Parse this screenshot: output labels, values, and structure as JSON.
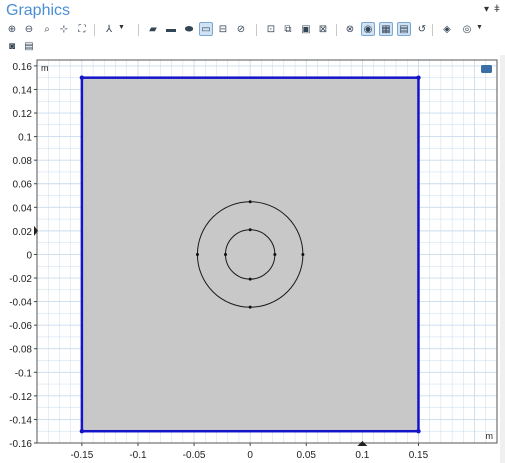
{
  "window": {
    "title": "Graphics"
  },
  "toolbar": {
    "row1": [
      {
        "name": "zoom-in-icon",
        "glyph": "⊕"
      },
      {
        "name": "zoom-out-icon",
        "glyph": "⊖"
      },
      {
        "name": "zoom-box-icon",
        "glyph": "⌕"
      },
      {
        "name": "zoom-selected-icon",
        "glyph": "⊹"
      },
      {
        "name": "zoom-extents-icon",
        "glyph": "⛶"
      },
      {
        "name": "axis-orientation-icon",
        "glyph": "⅄",
        "dropdown": true
      },
      {
        "name": "select-object-icon",
        "glyph": "▰"
      },
      {
        "name": "select-domains-icon",
        "glyph": "▬"
      },
      {
        "name": "select-boundaries-icon",
        "glyph": "⬬"
      },
      {
        "name": "select-edges-icon",
        "glyph": "▭",
        "pressed": true
      },
      {
        "name": "select-points-icon",
        "glyph": "⊟"
      },
      {
        "name": "select-none-icon",
        "glyph": "⊘"
      },
      {
        "name": "select-all-icon",
        "glyph": "⊡"
      },
      {
        "name": "hide-show-icon",
        "glyph": "⧉"
      },
      {
        "name": "build-selected-icon",
        "glyph": "▣"
      },
      {
        "name": "build-all-icon",
        "glyph": "⊠"
      },
      {
        "name": "transparency-icon",
        "glyph": "⊗"
      },
      {
        "name": "wireframe-rendering-icon",
        "glyph": "◉",
        "pressed": true
      },
      {
        "name": "show-grid-icon",
        "glyph": "▦",
        "pressed": true
      },
      {
        "name": "show-labels-icon",
        "glyph": "▤",
        "pressed": true
      },
      {
        "name": "reset-view-icon",
        "glyph": "↺"
      },
      {
        "name": "scene-light-icon",
        "glyph": "◈"
      },
      {
        "name": "render-mode-icon",
        "glyph": "◎",
        "dropdown": true
      }
    ],
    "row2": [
      {
        "name": "camera-icon",
        "glyph": "◙"
      },
      {
        "name": "print-icon",
        "glyph": "▤"
      }
    ],
    "pin_icon": "📌"
  },
  "colors": {
    "title": "#4a8fd4",
    "geometry_fill": "#c8c8c8",
    "selected_edge": "#1414c8",
    "grid": "#c9dced",
    "circle_stroke": "#1a1a1a"
  },
  "chart_data": {
    "type": "geometry-2d",
    "xlim": [
      -0.19,
      0.22
    ],
    "ylim": [
      -0.16,
      0.165
    ],
    "x_unit": "m",
    "y_unit": "m",
    "x_ticks": [
      -0.15,
      -0.1,
      -0.05,
      0,
      0.05,
      0.1,
      0.15
    ],
    "x_tick_labels": [
      "-0.15",
      "-0.1",
      "-0.05",
      "0",
      "0.05",
      "0.1",
      "0.15"
    ],
    "y_ticks": [
      0.16,
      0.14,
      0.12,
      0.1,
      0.08,
      0.06,
      0.04,
      0.02,
      0,
      -0.02,
      -0.04,
      -0.06,
      -0.08,
      -0.1,
      -0.12,
      -0.14,
      -0.16
    ],
    "y_tick_labels": [
      "0.16",
      "0.14",
      "0.12",
      "0.1",
      "0.08",
      "0.06",
      "0.04",
      "0.02",
      "0",
      "-0.02",
      "-0.04",
      "-0.06",
      "-0.08",
      "-0.1",
      "-0.12",
      "-0.14",
      "-0.16"
    ],
    "rectangle": {
      "x0": -0.15,
      "y0": -0.15,
      "x1": 0.15,
      "y1": 0.15
    },
    "circles": [
      {
        "cx": 0,
        "cy": 0,
        "r": 0.047
      },
      {
        "cx": 0,
        "cy": 0,
        "r": 0.022
      }
    ],
    "grid": true
  }
}
